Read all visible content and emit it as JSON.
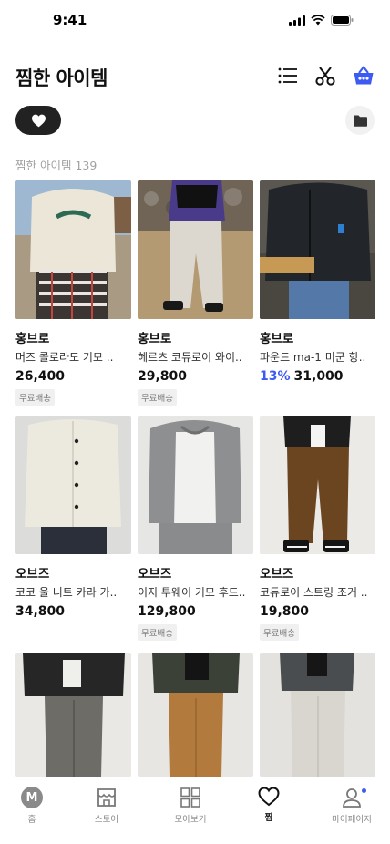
{
  "status_bar": {
    "time": "9:41"
  },
  "header": {
    "title": "찜한 아이템"
  },
  "list": {
    "count_label": "찜한 아이템 139"
  },
  "items": [
    {
      "brand": "홍브로",
      "name": "머즈 콜로라도 기모 ..",
      "discount": "",
      "price": "26,400",
      "badge": "무료배송"
    },
    {
      "brand": "홍브로",
      "name": "헤르츠 코듀로이 와이..",
      "discount": "",
      "price": "29,800",
      "badge": "무료배송"
    },
    {
      "brand": "홍브로",
      "name": "파운드 ma-1 미군 항..",
      "discount": "13%",
      "price": "31,000",
      "badge": ""
    },
    {
      "brand": "오브즈",
      "name": "코코 울 니트 카라 가..",
      "discount": "",
      "price": "34,800",
      "badge": ""
    },
    {
      "brand": "오브즈",
      "name": "이지 투웨이 기모 후드..",
      "discount": "",
      "price": "129,800",
      "badge": "무료배송"
    },
    {
      "brand": "오브즈",
      "name": "코듀로이 스트링 조거 ..",
      "discount": "",
      "price": "19,800",
      "badge": "무료배송"
    }
  ],
  "tabbar": {
    "home": "홈",
    "home_avatar": "M",
    "store": "스토어",
    "browse": "모아보기",
    "likes": "찜",
    "mypage": "마이페이지"
  },
  "colors": {
    "accent": "#3d5af1",
    "chip": "#222222"
  }
}
